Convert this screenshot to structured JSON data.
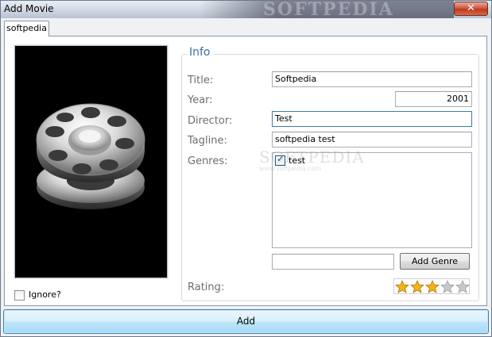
{
  "window": {
    "title": "Add Movie",
    "close_glyph": "✕"
  },
  "tab": {
    "label": "softpedia"
  },
  "poster": {
    "icon": "film-reel-icon"
  },
  "ignore": {
    "label": "Ignore?",
    "checked": false
  },
  "info": {
    "title": "Info",
    "fields": {
      "title_label": "Title:",
      "title_value": "Softpedia",
      "year_label": "Year:",
      "year_value": "2001",
      "director_label": "Director:",
      "director_value": "Test",
      "tagline_label": "Tagline:",
      "tagline_value": "softpedia test",
      "genres_label": "Genres:"
    },
    "genres": [
      {
        "name": "test",
        "checked": true
      }
    ],
    "new_genre_value": "",
    "add_genre_label": "Add Genre",
    "rating_label": "Rating:",
    "rating": 3,
    "rating_max": 5
  },
  "watermark": {
    "text": "SOFTPEDIA",
    "url": "www.softpedia.com"
  },
  "add_button_label": "Add",
  "colors": {
    "accent": "#3d6fa8",
    "star_filled": "#f2b21c",
    "star_empty": "#c8c8c8"
  }
}
